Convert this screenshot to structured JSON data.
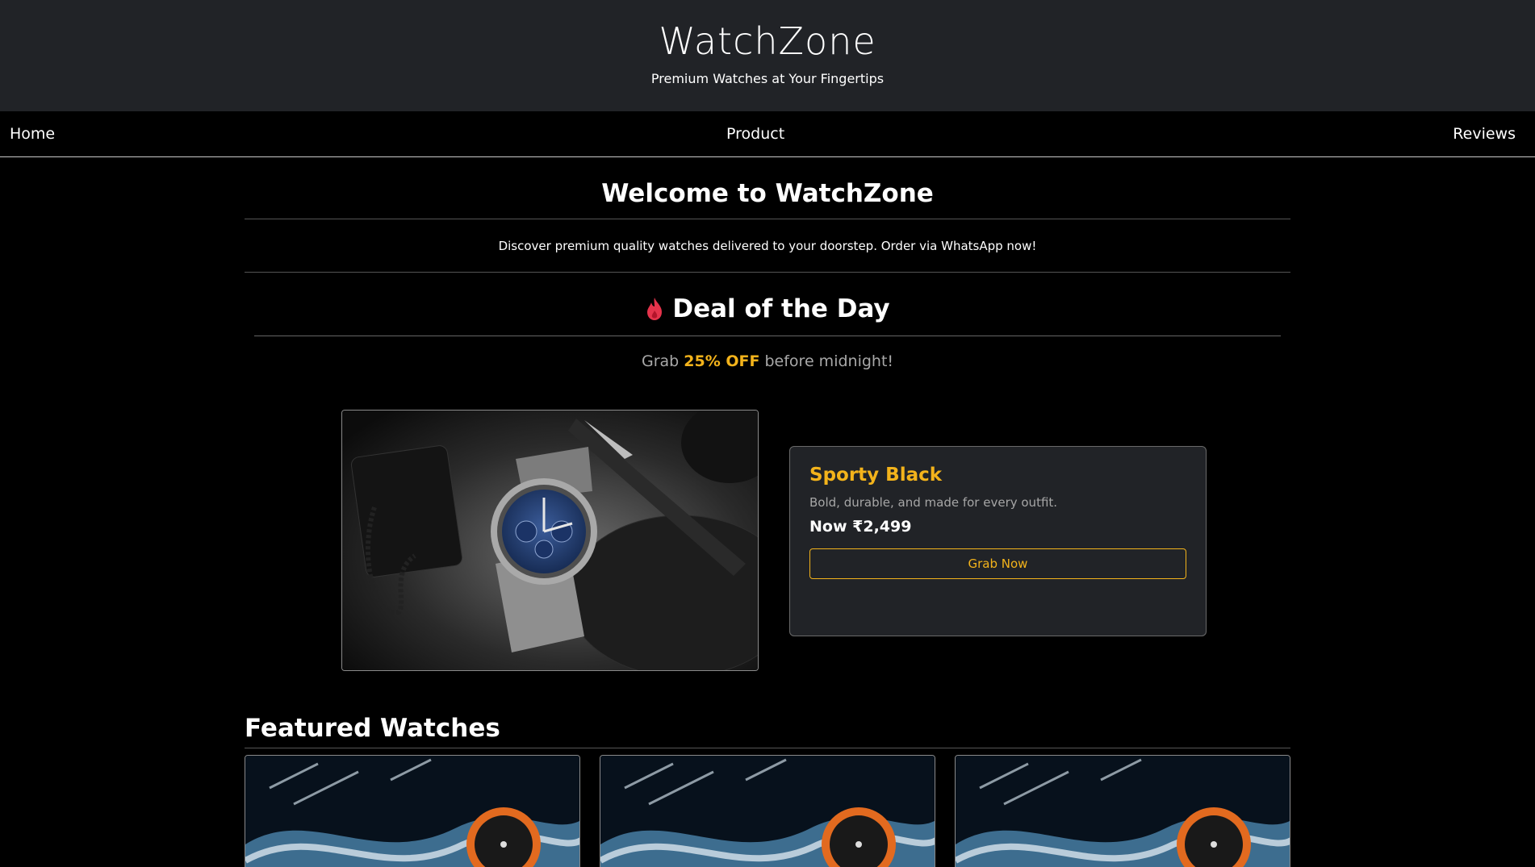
{
  "header": {
    "brand": "WatchZone",
    "tagline": "Premium Watches at Your Fingertips"
  },
  "nav": {
    "items": [
      {
        "label": "Home"
      },
      {
        "label": "Product"
      },
      {
        "label": "Reviews"
      }
    ]
  },
  "welcome": {
    "title": "Welcome to WatchZone",
    "text": "Discover premium quality watches delivered to your doorstep. Order via WhatsApp now!"
  },
  "deal": {
    "icon": "fire-icon",
    "title": "Deal of the Day",
    "sub_prefix": "Grab ",
    "sub_highlight": "25% OFF",
    "sub_suffix": " before midnight!",
    "product": {
      "name": "Sporty Black",
      "description": "Bold, durable, and made for every outfit.",
      "price": "Now ₹2,499",
      "button_label": "Grab Now"
    }
  },
  "featured": {
    "title": "Featured Watches",
    "cards": [
      {
        "image": "orange-bezel-watch-in-water-splash"
      },
      {
        "image": "orange-bezel-watch-in-water-splash"
      },
      {
        "image": "orange-bezel-watch-in-water-splash"
      }
    ]
  },
  "colors": {
    "accent": "#f3b31b",
    "header_bg": "#212327",
    "page_bg": "#000000",
    "card_bg": "#212327"
  }
}
